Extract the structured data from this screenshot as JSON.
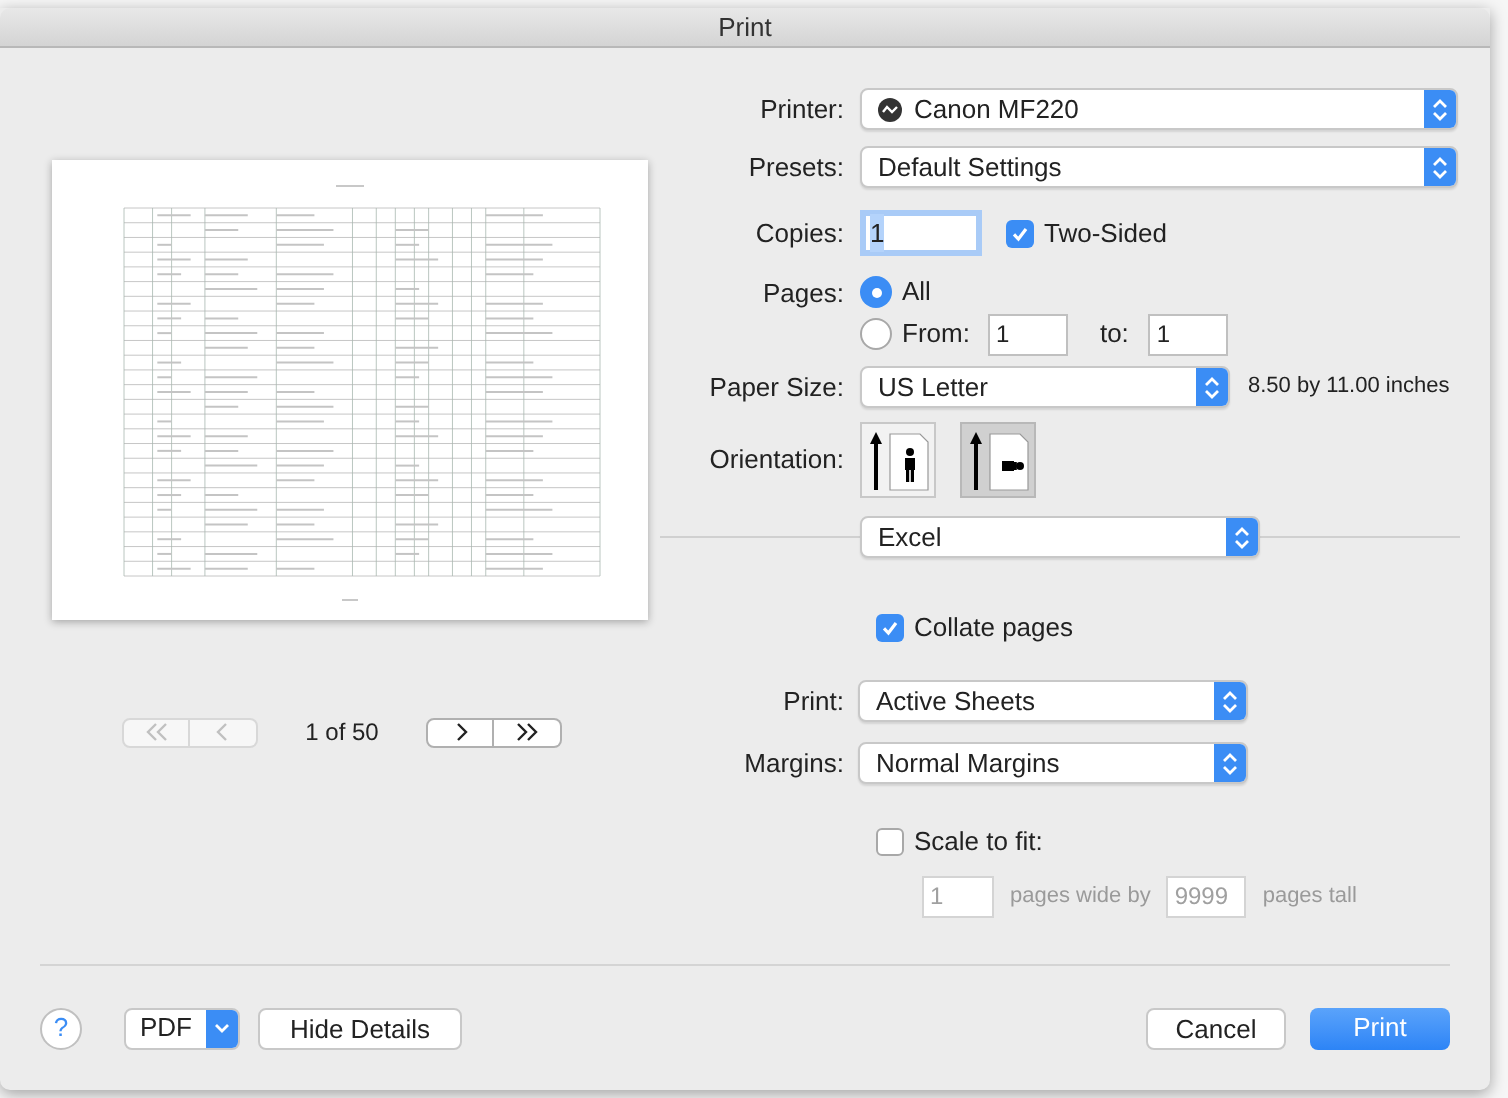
{
  "window": {
    "title": "Print"
  },
  "preview": {
    "page_indicator": "1 of 50",
    "nav_buttons": [
      {
        "kind": "first",
        "disabled": true
      },
      {
        "kind": "prev",
        "disabled": true
      },
      {
        "kind": "next",
        "disabled": false
      },
      {
        "kind": "last",
        "disabled": false
      }
    ]
  },
  "printer": {
    "label": "Printer:",
    "value": "Canon MF220"
  },
  "presets": {
    "label": "Presets:",
    "value": "Default Settings"
  },
  "copies": {
    "label": "Copies:",
    "value": "1"
  },
  "two_sided": {
    "label": "Two-Sided",
    "checked": true
  },
  "pages": {
    "label": "Pages:",
    "options": [
      {
        "label": "All",
        "selected": true
      },
      {
        "label": "From:",
        "selected": false
      }
    ],
    "from": "1",
    "to_label": "to:",
    "to": "1"
  },
  "paper_size": {
    "label": "Paper Size:",
    "value": "US Letter",
    "dimensions": "8.50 by 11.00 inches"
  },
  "orientation": {
    "label": "Orientation:",
    "options": [
      {
        "kind": "portrait",
        "selected": false
      },
      {
        "kind": "landscape",
        "selected": true
      }
    ]
  },
  "section_menu": {
    "value": "Excel"
  },
  "collate": {
    "label": "Collate pages",
    "checked": true
  },
  "print_what": {
    "label": "Print:",
    "value": "Active Sheets"
  },
  "margins": {
    "label": "Margins:",
    "value": "Normal Margins"
  },
  "scale_to_fit": {
    "label": "Scale to fit:",
    "checked": false,
    "wide": "1",
    "wide_label": "pages wide by",
    "tall": "9999",
    "tall_label": "pages tall"
  },
  "footer": {
    "help": "?",
    "pdf": "PDF",
    "hide_details": "Hide Details",
    "cancel": "Cancel",
    "print": "Print"
  }
}
